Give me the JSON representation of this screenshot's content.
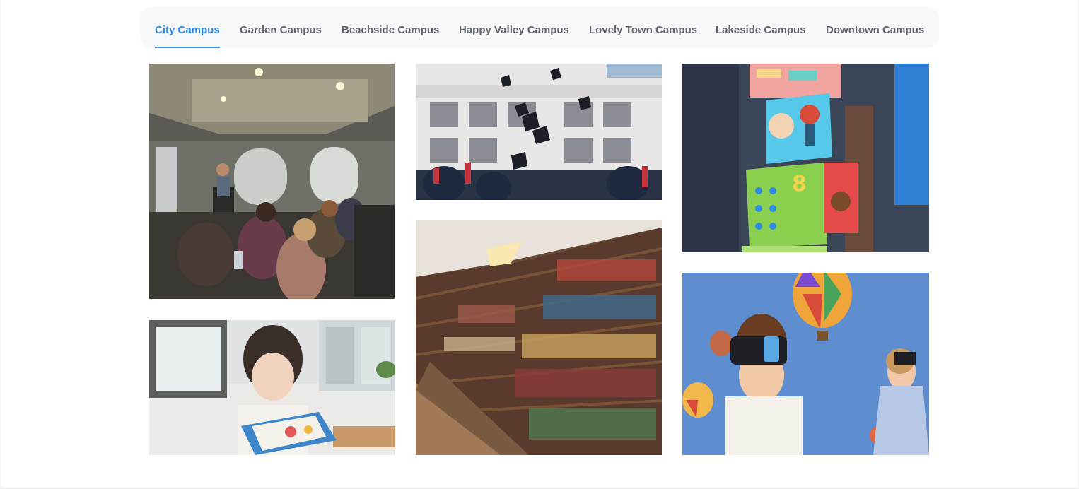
{
  "tabs": [
    {
      "label": "City Campus",
      "active": true
    },
    {
      "label": "Garden Campus",
      "active": false
    },
    {
      "label": "Beachside Campus",
      "active": false
    },
    {
      "label": "Happy Valley Campus",
      "active": false
    },
    {
      "label": "Lovely Town Campus",
      "active": false
    },
    {
      "label": "Lakeside Campus",
      "active": false
    },
    {
      "label": "Downtown Campus",
      "active": false
    }
  ],
  "colors": {
    "accent": "#2f8ae8",
    "tab_text": "#5e6470",
    "tab_bar_bg": "#f7f8fa"
  },
  "gallery": [
    {
      "id": "lecture-room-photo"
    },
    {
      "id": "girl-reading-photo"
    },
    {
      "id": "graduation-caps-photo"
    },
    {
      "id": "library-bookshelves-photo"
    },
    {
      "id": "toy-blocks-photo"
    },
    {
      "id": "vr-headset-kids-photo"
    }
  ]
}
